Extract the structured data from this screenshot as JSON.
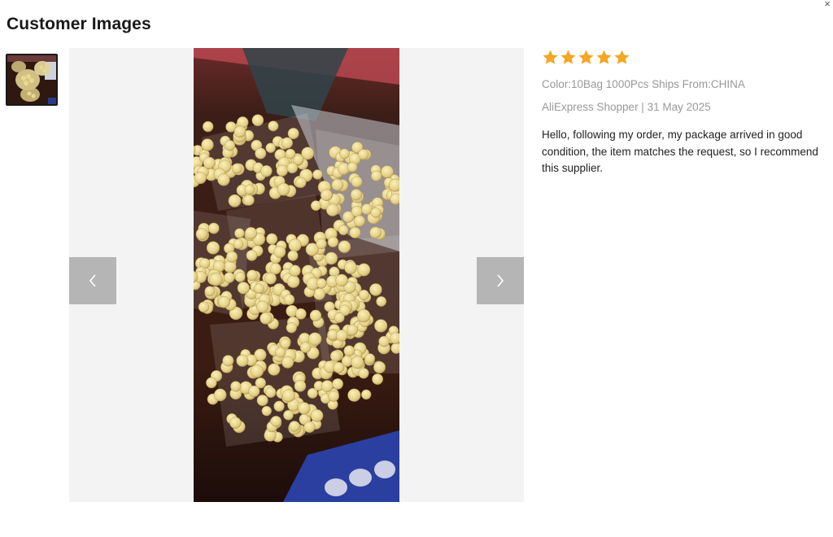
{
  "title": "Customer Images",
  "close_glyph": "×",
  "icons": {
    "close": "close-icon",
    "prev": "chevron-left-icon",
    "next": "chevron-right-icon",
    "star": "star-icon"
  },
  "review": {
    "rating": 5,
    "rating_max": 5,
    "star_color": "#f5a623",
    "sku": "Color:10Bag 1000Pcs Ships From:CHINA",
    "author_date": "AliExpress Shopper | 31 May 2025",
    "text": "Hello, following my order, my package arrived in good condition, the item matches the request, so I recommend this supplier."
  },
  "gallery": {
    "image_count": 1,
    "selected_index": 0,
    "image_subject": "photo-of-bagged-yellow-beads"
  }
}
